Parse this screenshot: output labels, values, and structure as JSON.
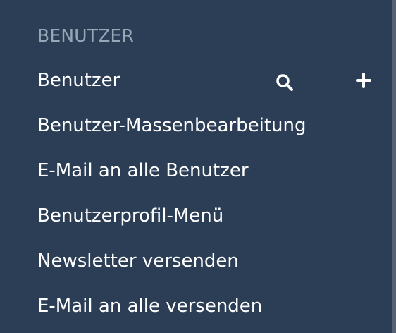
{
  "sidebar": {
    "section_title": "BENUTZER",
    "items": [
      {
        "label": "Benutzer"
      },
      {
        "label": "Benutzer-Massenbearbeitung"
      },
      {
        "label": "E-Mail an alle Benutzer"
      },
      {
        "label": "Benutzerprofil-Menü"
      },
      {
        "label": "Newsletter versenden"
      },
      {
        "label": "E-Mail an alle versenden"
      }
    ],
    "first_item_actions": {
      "search_icon": "search-icon",
      "add_icon": "plus-icon"
    }
  },
  "colors": {
    "background": "#2c3e56",
    "section_title": "#96a7b7",
    "text": "#ffffff",
    "scrollbar": "#566273"
  }
}
